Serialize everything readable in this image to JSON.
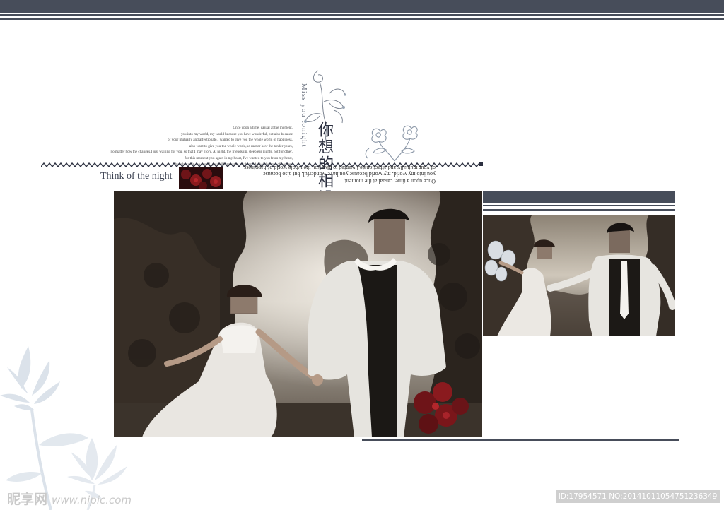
{
  "palette": {
    "navy": "#474d5a",
    "deep": "#2c3040",
    "mist": "#9aa6b5"
  },
  "header": {
    "bar_color": "#474d5a"
  },
  "heading": {
    "english_vertical": "Miss you tonight",
    "chinese_vertical": "你想的相设",
    "tagline": "Think of the night"
  },
  "passage": {
    "lines": [
      "Once upon a time, casual at the moment,",
      "you into my world, my world because you have wonderful, but also because",
      "of your mutually and affectionate,I wanted to give you the whole world of happiness,",
      "also want to give you the whole world,no matter how the tender years,",
      "no matter how the changes,I just waiting for you, so that I may glory. At night, the friendship, sleepless nights, not for other,",
      "for this moment you again in my heart, I've wanted to you from my heart,",
      "but always in the casual, you will appear in my heart. Alake! the soul of heaven."
    ],
    "mirrored_lines": [
      "Once upon a time, casual at the moment,",
      "you into my world, my world because you have wonderful, but also because",
      "of your mutually and affectionate,I wanted to give you the whole world of happiness,"
    ]
  },
  "photos": {
    "main_icon": "couple-holding-hands-photo",
    "side_icon": "couple-with-balloons-photo",
    "thumb_icon": "red-roses-photo"
  },
  "decor": {
    "left_flower_icon": "lotus-flower-icon",
    "top_flower_icon": "rose-sketch-icon",
    "scroll_icon": "floral-scroll-icon"
  },
  "watermark": {
    "left_cn": "昵享网",
    "left_url": "www.nipic.com",
    "right_id": "ID:17954571 NO:20141011054751236349"
  }
}
